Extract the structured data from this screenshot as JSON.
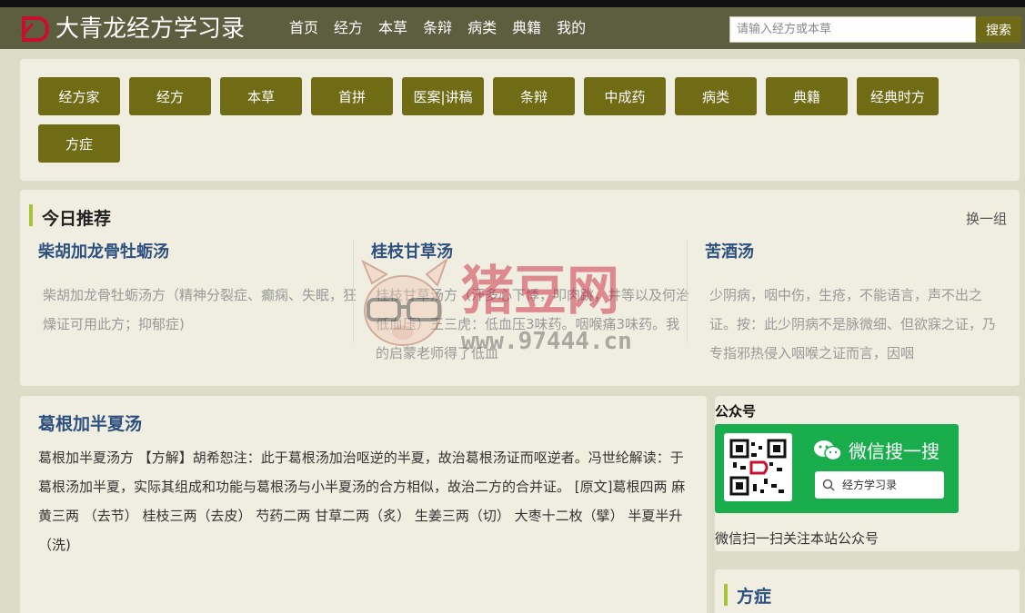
{
  "header": {
    "site_title": "大青龙经方学习录",
    "nav": [
      "首页",
      "经方",
      "本草",
      "条辩",
      "病类",
      "典籍",
      "我的"
    ],
    "search_placeholder": "请输入经方或本草",
    "search_button": "搜索"
  },
  "categories": [
    "经方家",
    "经方",
    "本草",
    "首拼",
    "医案|讲稿",
    "条辩",
    "中成药",
    "病类",
    "典籍",
    "经典时方",
    "方症"
  ],
  "recommend": {
    "title": "今日推荐",
    "swap": "换一组",
    "items": [
      {
        "title": "柴胡加龙骨牡蛎汤",
        "desc": "柴胡加龙骨牡蛎汤方（精神分裂症、癫痫、失眠，狂燥证可用此方；抑郁症)"
      },
      {
        "title": "桂枝甘草汤",
        "desc": "桂枝甘草汤方（汗多心下悸，叩肉跳，井等以及何治低血压）王三虎：低血压3味药。咽喉痛3味药。我的启蒙老师得了低血"
      },
      {
        "title": "苦酒汤",
        "desc": "少阴病，咽中伤，生疮，不能语言，声不出之证。按：此少阴病不是脉微细、但欲寐之证，乃专指邪热侵入咽喉之证而言，因咽"
      }
    ]
  },
  "main": {
    "title": "葛根加半夏汤",
    "body": "葛根加半夏汤方 【方解】胡希恕注：此于葛根汤加治呕逆的半夏，故治葛根汤证而呕逆者。冯世纶解读：于葛根汤加半夏，实际其组成和功能与葛根汤与小半夏汤的合方相似，故治二方的合并证。 [原文]葛根四两 麻黄三两 （去节） 桂枝三两（去皮） 芍药二两 甘草二两（炙） 生姜三两（切） 大枣十二枚（擘） 半夏半升（洗)"
  },
  "sidebar": {
    "wechat_title": "公众号",
    "wechat_slogan": "微信搜一搜",
    "wechat_search": "经方学习录",
    "wechat_caption": "微信扫一扫关注本站公众号",
    "fangzheng_title": "方症"
  },
  "watermark": {
    "brand": "猪豆网",
    "url": "www.97444.cn"
  },
  "colors": {
    "header_bg": "#5d5d40",
    "button_olive": "#706b15",
    "link_blue": "#2d5080",
    "accent_green": "#a6c33a",
    "wechat_green": "#1aad4e"
  }
}
